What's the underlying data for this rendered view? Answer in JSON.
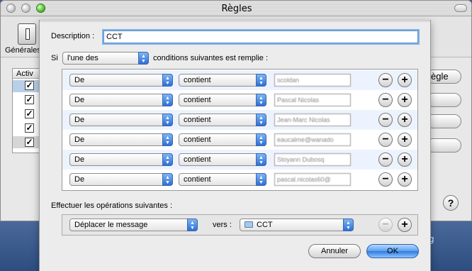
{
  "window": {
    "title": "Règles"
  },
  "bg": {
    "toolbar_label": "Générales",
    "list_header": "Activ",
    "rules_button": "ègle"
  },
  "desktop": {
    "text": "ong"
  },
  "sheet": {
    "description_label": "Description :",
    "description_value": "CCT",
    "si_label": "Si",
    "match_mode": "l'une des",
    "conditions_suffix": "conditions suivantes est remplie :",
    "conditions": [
      {
        "field": "De",
        "operator": "contient",
        "value": "scoldan"
      },
      {
        "field": "De",
        "operator": "contient",
        "value": "Pascal Nicolas"
      },
      {
        "field": "De",
        "operator": "contient",
        "value": "Jean-Marc Nicolas"
      },
      {
        "field": "De",
        "operator": "contient",
        "value": "eaucalme@wanado"
      },
      {
        "field": "De",
        "operator": "contient",
        "value": "Stoyann Dubosq"
      },
      {
        "field": "De",
        "operator": "contient",
        "value": "pascal.nicolas60@"
      }
    ],
    "actions_label": "Effectuer les opérations suivantes :",
    "action": {
      "operation": "Déplacer le message",
      "vers_label": "vers :",
      "destination": "CCT"
    },
    "minus": "−",
    "plus": "+",
    "cancel_label": "Annuler",
    "ok_label": "OK"
  }
}
